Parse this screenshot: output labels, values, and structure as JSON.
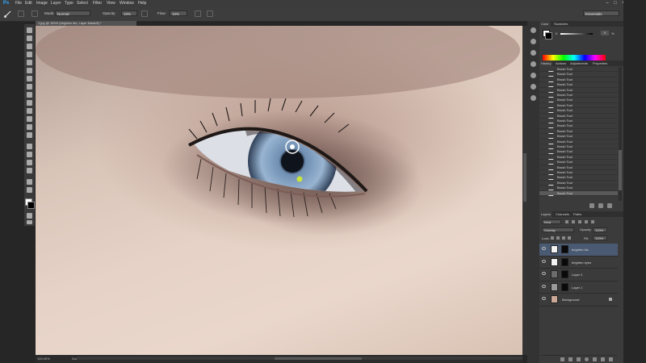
{
  "app": {
    "logo": "Ps"
  },
  "menu": [
    "File",
    "Edit",
    "Image",
    "Layer",
    "Type",
    "Select",
    "Filter",
    "View",
    "Window",
    "Help"
  ],
  "options": {
    "mode_label": "Mode:",
    "mode_value": "Normal",
    "opacity_label": "Opacity:",
    "opacity_value": "10%",
    "flow_label": "Flow:",
    "flow_value": "10%",
    "workspace": "Essentials"
  },
  "document": {
    "tab_title": "1.jpg @ 100% (brighten iris, Layer Mask/8) *",
    "zoom": "100.00%",
    "doc_info": "Doc: 60.2M/362.5M"
  },
  "color_panel": {
    "tabs": [
      "Color",
      "Swatches"
    ],
    "k_label": "K",
    "k_value": "0",
    "k_unit": "%"
  },
  "history_panel": {
    "tabs": [
      "History",
      "Actions",
      "Adjustments",
      "Properties"
    ],
    "items": [
      "Brush Tool",
      "Brush Tool",
      "Brush Tool",
      "Brush Tool",
      "Brush Tool",
      "Brush Tool",
      "Brush Tool",
      "Brush Tool",
      "Brush Tool",
      "Brush Tool",
      "Brush Tool",
      "Brush Tool",
      "Brush Tool",
      "Brush Tool",
      "Brush Tool",
      "Brush Tool",
      "Brush Tool",
      "Brush Tool",
      "Brush Tool",
      "Brush Tool",
      "Brush Tool",
      "Brush Tool",
      "Brush Tool",
      "Brush Tool",
      "Brush Tool"
    ],
    "selected_index": 24
  },
  "layers_panel": {
    "tabs": [
      "Layers",
      "Channels",
      "Paths"
    ],
    "kind_label": "Kind",
    "blend_mode": "Overlay",
    "opacity_label": "Opacity:",
    "opacity_value": "100%",
    "lock_label": "Lock:",
    "fill_label": "Fill:",
    "fill_value": "100%",
    "layers": [
      {
        "name": "brighten iris",
        "selected": true
      },
      {
        "name": "brighten eyes",
        "selected": false
      },
      {
        "name": "Layer 2",
        "selected": false
      },
      {
        "name": "Layer 1",
        "selected": false
      },
      {
        "name": "Background",
        "selected": false
      }
    ]
  },
  "colors": {
    "panel_bg": "#3b3b3b",
    "selected_layer": "#4b5a73",
    "selected_history": "#5a5a5a",
    "accent_blue": "#31a8ff"
  }
}
